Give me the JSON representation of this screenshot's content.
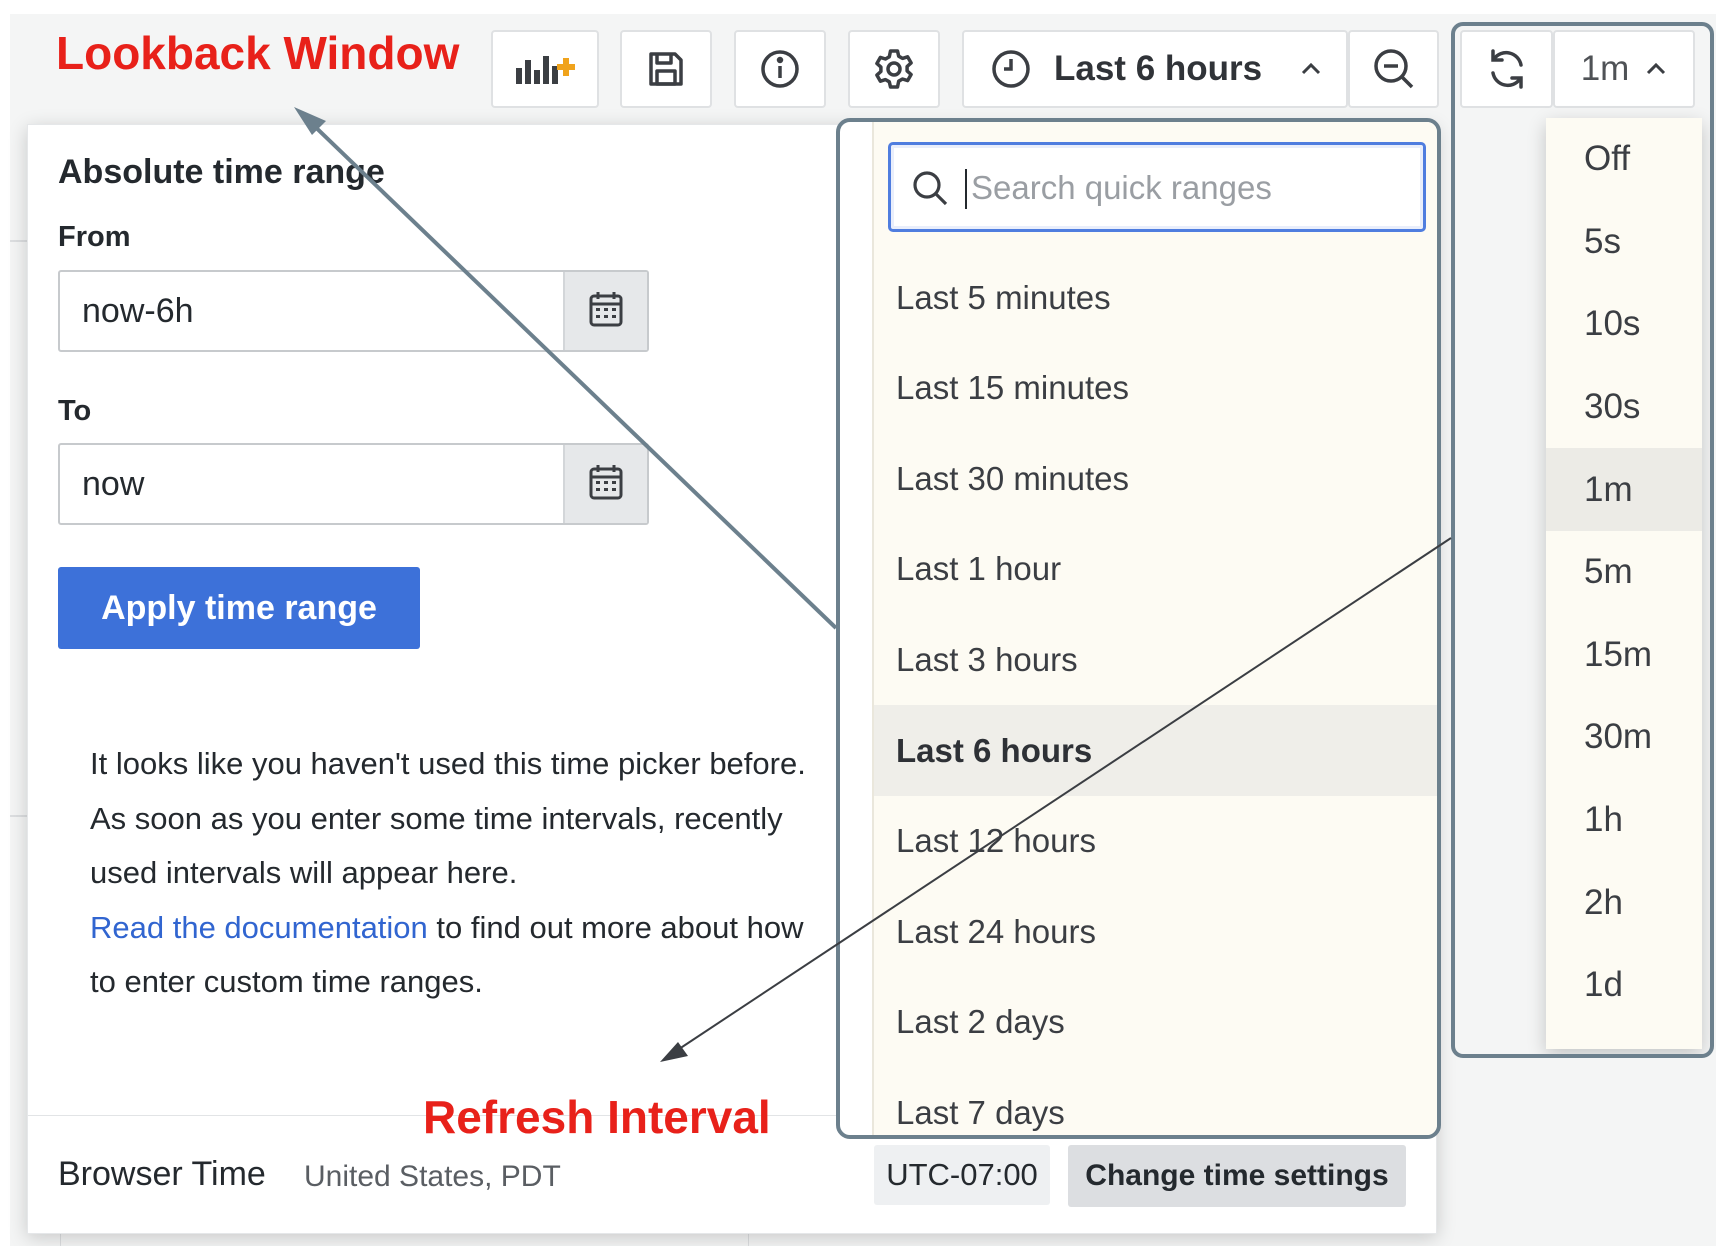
{
  "annotations": {
    "lookback": "Lookback Window",
    "refresh": "Refresh Interval"
  },
  "toolbar": {
    "add_panel_icon": "add-panel-icon",
    "save_icon": "save-icon",
    "info_icon": "info-icon",
    "settings_icon": "gear-icon",
    "time_range_label": "Last 6 hours",
    "zoom_out_icon": "zoom-out-icon",
    "refresh_icon": "refresh-icon",
    "refresh_interval": "1m"
  },
  "absolute_range": {
    "title": "Absolute time range",
    "from_label": "From",
    "from_value": "now-6h",
    "to_label": "To",
    "to_value": "now",
    "apply_label": "Apply time range"
  },
  "help": {
    "text": "It looks like you haven't used this time picker before. As soon as you enter some time intervals, recently used intervals will appear here.",
    "link": "Read the documentation",
    "after_link": " to find out more about how to enter custom time ranges."
  },
  "footer": {
    "browser_time": "Browser Time",
    "timezone": "United States, PDT",
    "utc_offset": "UTC-07:00",
    "change_settings": "Change time settings"
  },
  "quick_ranges": {
    "search_placeholder": "Search quick ranges",
    "selected": "Last 6 hours",
    "items": [
      "Last 5 minutes",
      "Last 15 minutes",
      "Last 30 minutes",
      "Last 1 hour",
      "Last 3 hours",
      "Last 6 hours",
      "Last 12 hours",
      "Last 24 hours",
      "Last 2 days",
      "Last 7 days"
    ]
  },
  "refresh_intervals": {
    "selected": "1m",
    "items": [
      "Off",
      "5s",
      "10s",
      "30s",
      "1m",
      "5m",
      "15m",
      "30m",
      "1h",
      "2h",
      "1d"
    ]
  },
  "colors": {
    "accent": "#3d71d9",
    "annotation": "#e8211a",
    "highlight_border": "#6c808d"
  }
}
